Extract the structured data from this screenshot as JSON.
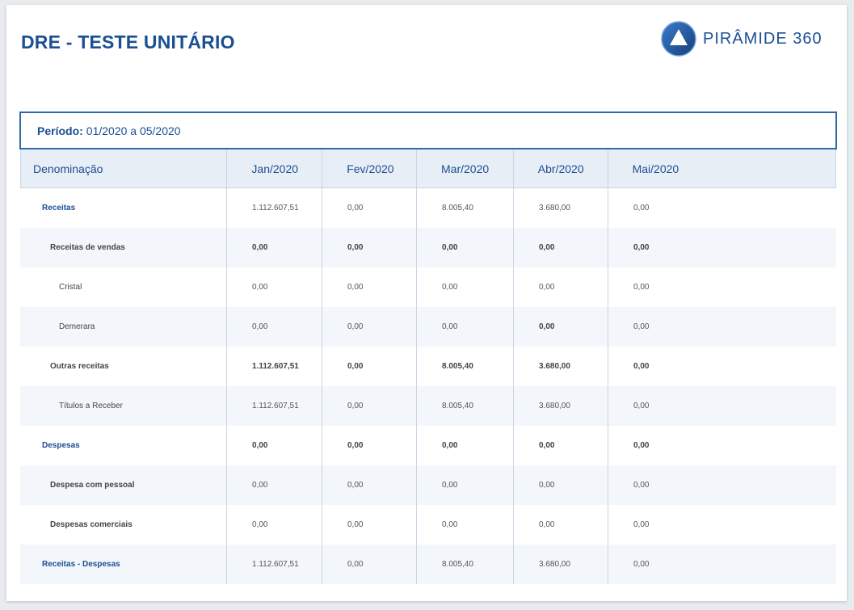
{
  "report": {
    "title": "DRE - TESTE UNITÁRIO",
    "logo_text": "PIRÂMIDE 360",
    "period_label": "Período:",
    "period_value": "01/2020 a 05/2020"
  },
  "table": {
    "headers": [
      "Denominação",
      "Jan/2020",
      "Fev/2020",
      "Mar/2020",
      "Abr/2020",
      "Mai/2020"
    ],
    "rows": [
      {
        "label": "Receitas",
        "values": [
          "1.112.607,51",
          "0,00",
          "8.005,40",
          "3.680,00",
          "0,00"
        ]
      },
      {
        "label": "Receitas de vendas",
        "values": [
          "0,00",
          "0,00",
          "0,00",
          "0,00",
          "0,00"
        ]
      },
      {
        "label": "Cristal",
        "values": [
          "0,00",
          "0,00",
          "0,00",
          "0,00",
          "0,00"
        ]
      },
      {
        "label": "Demerara",
        "values": [
          "0,00",
          "0,00",
          "0,00",
          "0,00",
          "0,00"
        ]
      },
      {
        "label": "Outras receitas",
        "values": [
          "1.112.607,51",
          "0,00",
          "8.005,40",
          "3.680,00",
          "0,00"
        ]
      },
      {
        "label": "Títulos a Receber",
        "values": [
          "1.112.607,51",
          "0,00",
          "8.005,40",
          "3.680,00",
          "0,00"
        ]
      },
      {
        "label": "Despesas",
        "values": [
          "0,00",
          "0,00",
          "0,00",
          "0,00",
          "0,00"
        ]
      },
      {
        "label": "Despesa com pessoal",
        "values": [
          "0,00",
          "0,00",
          "0,00",
          "0,00",
          "0,00"
        ]
      },
      {
        "label": "Despesas comerciais",
        "values": [
          "0,00",
          "0,00",
          "0,00",
          "0,00",
          "0,00"
        ]
      },
      {
        "label": "Receitas - Despesas",
        "values": [
          "1.112.607,51",
          "0,00",
          "8.005,40",
          "3.680,00",
          "0,00"
        ]
      }
    ]
  },
  "colors": {
    "brand": "#1b4f93",
    "header_bg": "#e8eef6",
    "alt_row_bg": "#f3f6fa"
  }
}
